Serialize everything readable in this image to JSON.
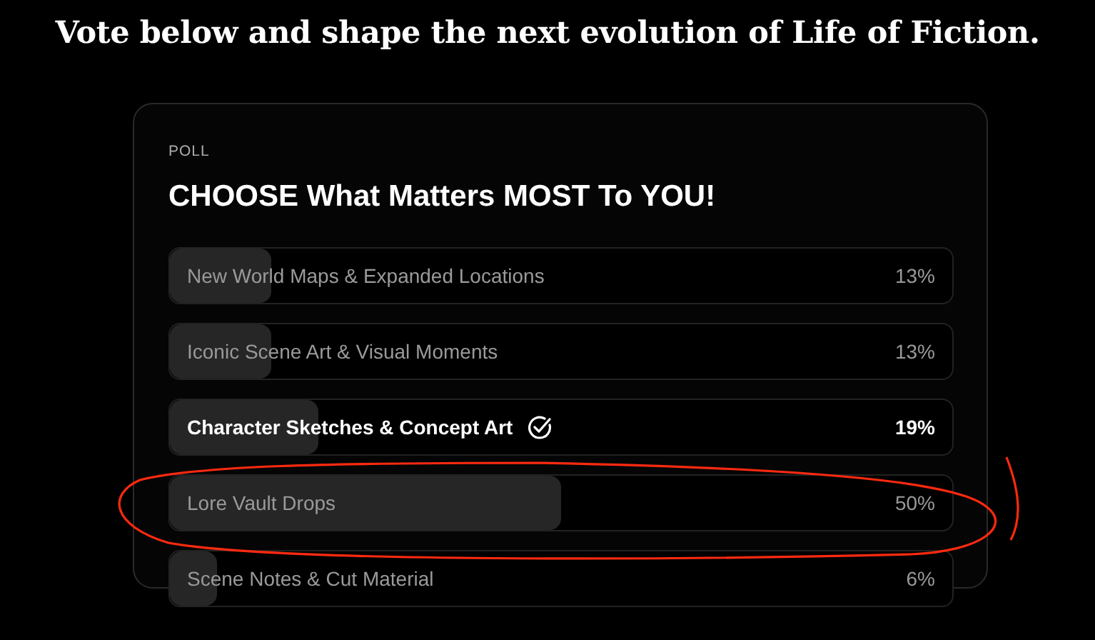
{
  "headline": "Vote below and shape the next evolution of Life of Fiction.",
  "poll": {
    "eyebrow": "POLL",
    "title": "CHOOSE What Matters MOST To YOU!",
    "options": [
      {
        "label": "New World Maps & Expanded Locations",
        "percent": "13%",
        "level": 0.13,
        "selected": false
      },
      {
        "label": "Iconic Scene Art & Visual Moments",
        "percent": "13%",
        "level": 0.13,
        "selected": false
      },
      {
        "label": "Character Sketches & Concept Art",
        "percent": "19%",
        "level": 0.19,
        "selected": true
      },
      {
        "label": "Lore Vault Drops",
        "percent": "50%",
        "level": 0.5,
        "selected": false
      },
      {
        "label": "Scene Notes & Cut Material",
        "percent": "6%",
        "level": 0.06,
        "selected": false
      }
    ]
  }
}
